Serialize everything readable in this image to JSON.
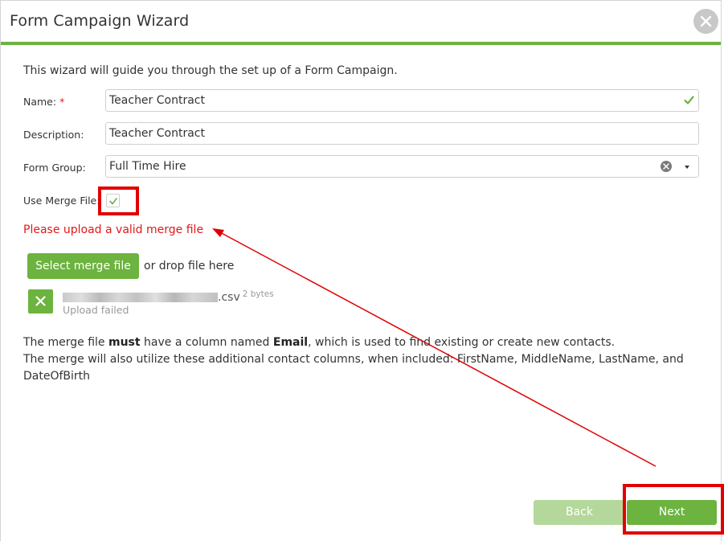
{
  "dialog": {
    "title": "Form Campaign Wizard"
  },
  "intro_text": "This wizard will guide you through the set up of a Form Campaign.",
  "fields": {
    "name": {
      "label": "Name:",
      "required_mark": "*",
      "value": "Teacher Contract"
    },
    "description": {
      "label": "Description:",
      "value": "Teacher Contract"
    },
    "form_group": {
      "label": "Form Group:",
      "value": "Full Time Hire"
    },
    "use_merge_file": {
      "label": "Use Merge File:",
      "checked": true
    }
  },
  "error_message": "Please upload a valid merge file",
  "upload": {
    "select_button": "Select merge file",
    "drop_text": "or drop file here",
    "file": {
      "extension": ".csv",
      "size": "2 bytes",
      "status": "Upload failed"
    }
  },
  "note": {
    "line1_prefix": "The merge file ",
    "line1_bold1": "must",
    "line1_mid": " have a column named ",
    "line1_bold2": "Email",
    "line1_suffix": ", which is used to find existing or create new contacts.",
    "line2": "The merge will also utilize these additional contact columns, when included: FirstName, MiddleName, LastName, and DateOfBirth"
  },
  "footer": {
    "back_label": "Back",
    "next_label": "Next"
  },
  "colors": {
    "accent_green": "#6cb33f",
    "disabled_green": "#b4d89b",
    "error_red": "#e01818",
    "annotation_red": "#e00000"
  },
  "icons": [
    "close-icon",
    "check-icon",
    "clear-icon",
    "caret-down-icon",
    "checkbox-check-icon",
    "upload-failed-icon"
  ]
}
